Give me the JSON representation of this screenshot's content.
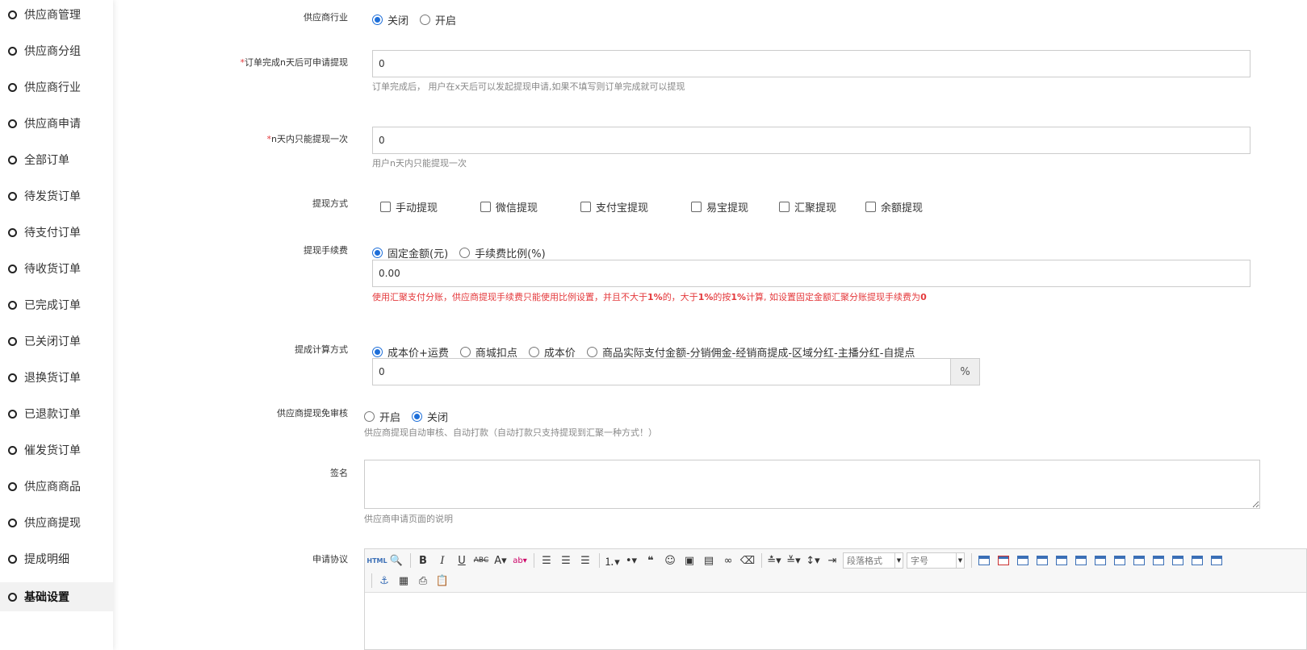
{
  "sidebar": {
    "items": [
      {
        "label": "供应商管理"
      },
      {
        "label": "供应商分组"
      },
      {
        "label": "供应商行业"
      },
      {
        "label": "供应商申请"
      },
      {
        "label": "全部订单"
      },
      {
        "label": "待发货订单"
      },
      {
        "label": "待支付订单"
      },
      {
        "label": "待收货订单"
      },
      {
        "label": "已完成订单"
      },
      {
        "label": "已关闭订单"
      },
      {
        "label": "退换货订单"
      },
      {
        "label": "已退款订单"
      },
      {
        "label": "催发货订单"
      },
      {
        "label": "供应商商品"
      },
      {
        "label": "供应商提现"
      },
      {
        "label": "提成明细"
      },
      {
        "label": "基础设置",
        "active": true
      }
    ]
  },
  "form": {
    "industry": {
      "label": "供应商行业",
      "options": [
        "关闭",
        "开启"
      ],
      "selected": 0
    },
    "withdraw_days": {
      "required_mark": "*",
      "label": "订单完成n天后可申请提现",
      "value": "0",
      "help": "订单完成后， 用户在x天后可以发起提现申请,如果不填写则订单完成就可以提现"
    },
    "withdraw_once": {
      "required_mark": "*",
      "label": "n天内只能提现一次",
      "value": "0",
      "help": "用户n天内只能提现一次"
    },
    "withdraw_methods": {
      "label": "提现方式",
      "options": [
        "手动提现",
        "微信提现",
        "支付宝提现",
        "易宝提现",
        "汇聚提现",
        "余额提现"
      ]
    },
    "withdraw_fee": {
      "label": "提现手续费",
      "options": [
        "固定金额(元)",
        "手续费比例(%)"
      ],
      "selected": 0,
      "value": "0.00",
      "help_parts": [
        "使用汇聚支付分账，供应商提现手续费只能使用比例设置，并且不大于",
        "1%",
        "的，大于",
        "1%",
        "的按",
        "1%",
        "计算, 如设置固定金额汇聚分账提现手续费为",
        "0"
      ]
    },
    "commission": {
      "label": "提成计算方式",
      "options": [
        "成本价+运费",
        "商城扣点",
        "成本价",
        "商品实际支付金额-分销佣金-经销商提成-区域分红-主播分红-自提点"
      ],
      "selected": 0,
      "value": "0",
      "addon": "%"
    },
    "auto_audit": {
      "label": "供应商提现免审核",
      "options": [
        "开启",
        "关闭"
      ],
      "selected": 1,
      "help": "供应商提现自动审核、自动打款（自动打款只支持提现到汇聚一种方式！）"
    },
    "signature": {
      "label": "签名",
      "value": "",
      "help": "供应商申请页面的说明"
    },
    "agreement": {
      "label": "申请协议",
      "toolbar": {
        "html_label": "HTML",
        "paragraph_placeholder": "段落格式",
        "fontsize_placeholder": "字号"
      }
    }
  },
  "colors": {
    "accent": "#1e6fd9",
    "required": "#e4393c"
  }
}
